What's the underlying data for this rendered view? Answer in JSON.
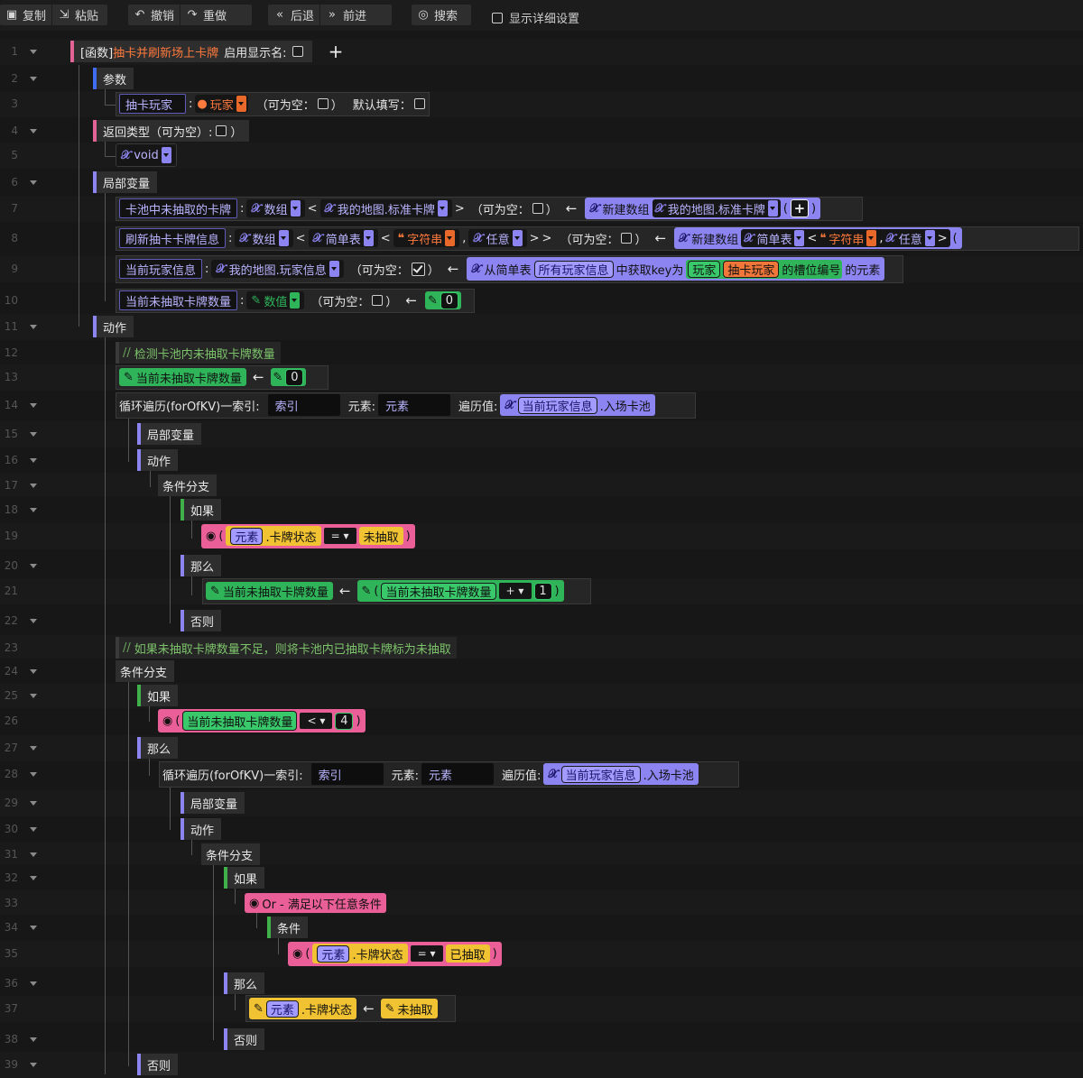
{
  "toolbar": {
    "copy": "复制",
    "paste": "粘贴",
    "undo": "撤销",
    "redo": "重做",
    "back": "后退",
    "forward": "前进",
    "search": "搜索",
    "details": "显示详细设置"
  },
  "rows": [
    "1",
    "2",
    "3",
    "4",
    "5",
    "6",
    "7",
    "8",
    "9",
    "10",
    "11",
    "12",
    "13",
    "14",
    "15",
    "16",
    "17",
    "18",
    "19",
    "20",
    "21",
    "22",
    "23",
    "24",
    "25",
    "26",
    "27",
    "28",
    "29",
    "30",
    "31",
    "32",
    "33",
    "34",
    "35",
    "36",
    "37",
    "38",
    "39"
  ],
  "func": {
    "prefix": "[函数]",
    "name": "抽卡并刷新场上卡牌",
    "display_name_label": "启用显示名:",
    "add": "+"
  },
  "labels": {
    "params": "参数",
    "return_type": "返回类型（可为空）:",
    "locals": "局部变量",
    "actions": "动作",
    "cond_branch": "条件分支",
    "if": "如果",
    "then": "那么",
    "else": "否则",
    "condition": "条件",
    "nullable": "（可为空：",
    "close_paren": "）",
    "default_fill": "默认填写：",
    "arrow": "←",
    "colon": ":",
    "lt": "<",
    "gt": ">",
    "comma": ",",
    "lparen": "(",
    "rparen": ")",
    "new_array": "新建数组",
    "loop": "循环遍历(forOfKV)一索引:",
    "elem_label": "元素:",
    "iter_label": "遍历值:",
    "index": "索引",
    "element": "元素",
    "dot_pool": ".入场卡池",
    "dot_state": ".卡牌状态",
    "or_any": "Or - 满足以下任意条件",
    "void": "void"
  },
  "param": {
    "name": "抽卡玩家",
    "type": "玩家"
  },
  "locals": [
    {
      "name": "卡池中未抽取的卡牌",
      "type_outer": "数组",
      "type_inner": "我的地图.标准卡牌"
    },
    {
      "name": "刷新抽卡卡牌信息",
      "type_outer": "数组",
      "type_mid": "简单表",
      "key_type": "字符串",
      "val_type": "任意"
    },
    {
      "name": "当前玩家信息",
      "type": "我的地图.玩家信息",
      "from": "从简单表",
      "table": "所有玩家信息",
      "get_key": "中获取key为",
      "player": "玩家",
      "player_var": "抽卡玩家",
      "slot": "的槽位编号",
      "tail": "的元素"
    },
    {
      "name": "当前未抽取卡牌数量",
      "type": "数值",
      "init": "0"
    }
  ],
  "comments": [
    "检测卡池内未抽取卡牌数量",
    "如果未抽取卡牌数量不足，则将卡池内已抽取卡牌标为未抽取"
  ],
  "vars": {
    "count": "当前未抽取卡牌数量",
    "player_info": "当前玩家信息"
  },
  "values": {
    "zero": "0",
    "one": "1",
    "four": "4",
    "undrawn": "未抽取",
    "drawn": "已抽取",
    "eq": "=",
    "plus": "+",
    "lt": "<"
  }
}
